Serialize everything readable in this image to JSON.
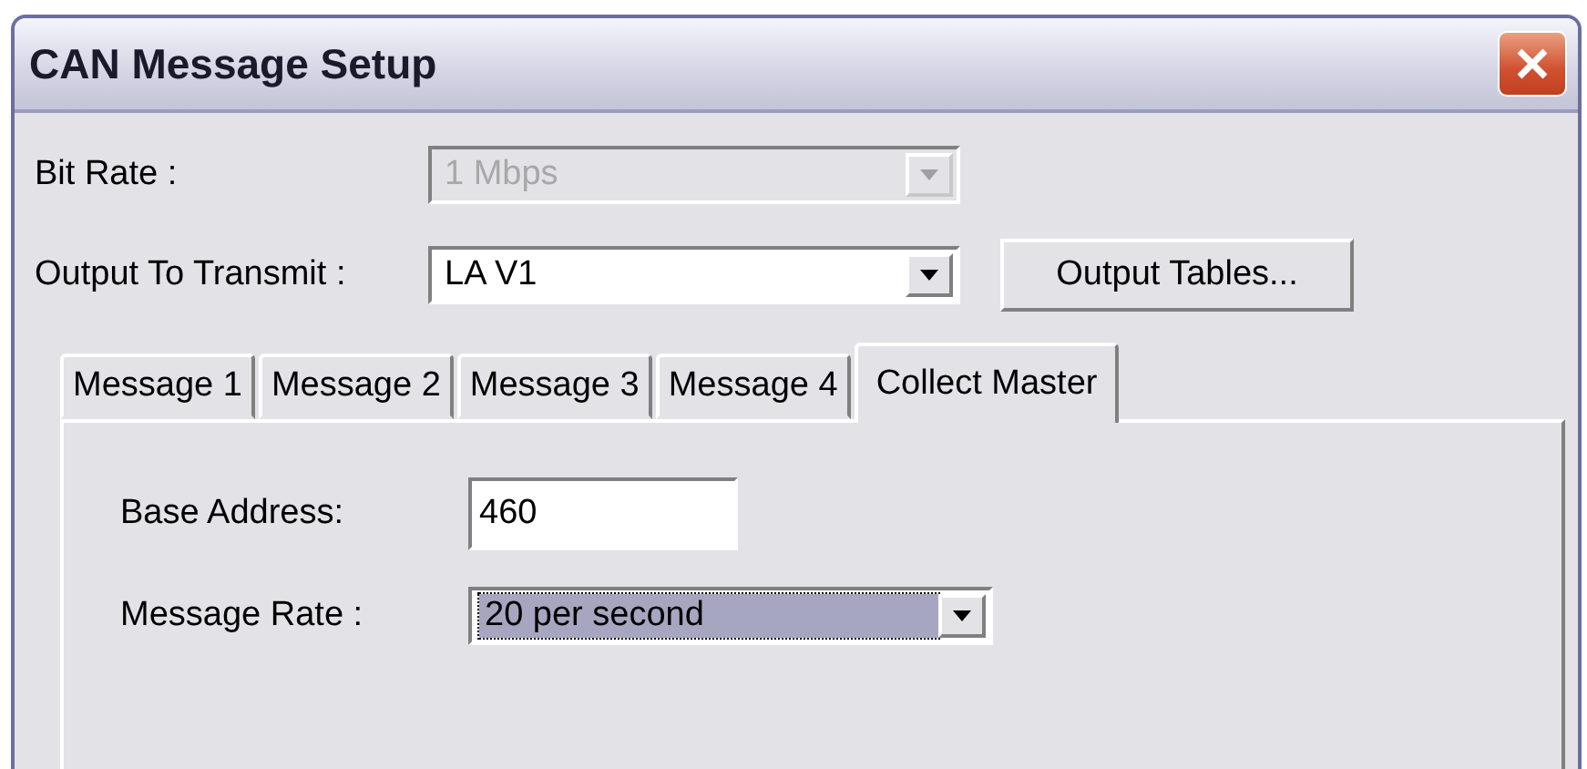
{
  "window": {
    "title": "CAN Message Setup"
  },
  "bit_rate": {
    "label": "Bit Rate :",
    "value": "1 Mbps",
    "disabled": true
  },
  "output_to_transmit": {
    "label": "Output To Transmit :",
    "value": "LA V1",
    "disabled": false
  },
  "output_tables_button": {
    "label": "Output Tables..."
  },
  "tabs": [
    {
      "label": "Message 1",
      "selected": false
    },
    {
      "label": "Message 2",
      "selected": false
    },
    {
      "label": "Message 3",
      "selected": false
    },
    {
      "label": "Message 4",
      "selected": false
    },
    {
      "label": "Collect Master",
      "selected": true
    }
  ],
  "base_address": {
    "label": "Base Address:",
    "value": "460"
  },
  "message_rate": {
    "label": "Message Rate :",
    "value": "20 per second",
    "focused": true
  }
}
